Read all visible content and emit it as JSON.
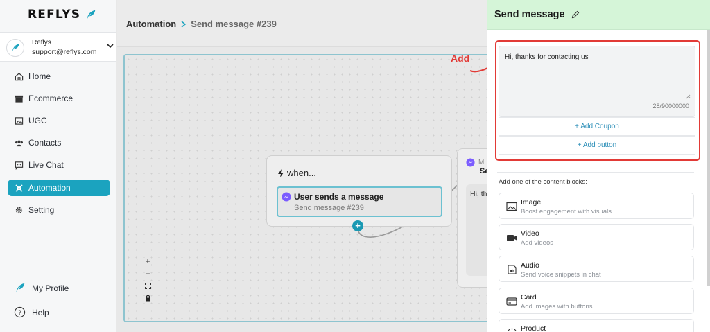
{
  "brand": {
    "name": "REFLYS",
    "accent": "#1ba3bf"
  },
  "account": {
    "name": "Reflys",
    "email": "support@reflys.com"
  },
  "nav": [
    {
      "label": "Home",
      "icon": "home-icon"
    },
    {
      "label": "Ecommerce",
      "icon": "store-icon"
    },
    {
      "label": "UGC",
      "icon": "image-icon"
    },
    {
      "label": "Contacts",
      "icon": "contacts-icon"
    },
    {
      "label": "Live Chat",
      "icon": "chat-icon"
    },
    {
      "label": "Automation",
      "icon": "automation-icon",
      "active": true
    },
    {
      "label": "Setting",
      "icon": "gear-icon"
    }
  ],
  "bottom": {
    "profile": "My Profile",
    "help": "Help"
  },
  "breadcrumb": {
    "root": "Automation",
    "current": "Send message #239"
  },
  "canvas": {
    "trigger": {
      "title": "when...",
      "label": "User sends a message",
      "sub": "Send message #239"
    },
    "message_card": {
      "head": "M",
      "title": "Se",
      "preview": "Hi, th"
    },
    "zoom": {
      "in": "+",
      "out": "−"
    }
  },
  "annotation": "Add",
  "panel": {
    "title": "Send message",
    "message_text": "Hi, thanks for contacting us",
    "char_count": "28/90000000",
    "add_coupon": "+ Add Coupon",
    "add_button": "+ Add button",
    "blocks_label": "Add one of the content blocks:",
    "blocks": [
      {
        "title": "Image",
        "desc": "Boost engagement with visuals",
        "icon": "image-block-icon"
      },
      {
        "title": "Video",
        "desc": "Add videos",
        "icon": "video-block-icon"
      },
      {
        "title": "Audio",
        "desc": "Send voice snippets in chat",
        "icon": "audio-block-icon"
      },
      {
        "title": "Card",
        "desc": "Add images with buttons",
        "icon": "card-block-icon"
      },
      {
        "title": "Product",
        "desc": "",
        "icon": "product-block-icon"
      }
    ]
  }
}
